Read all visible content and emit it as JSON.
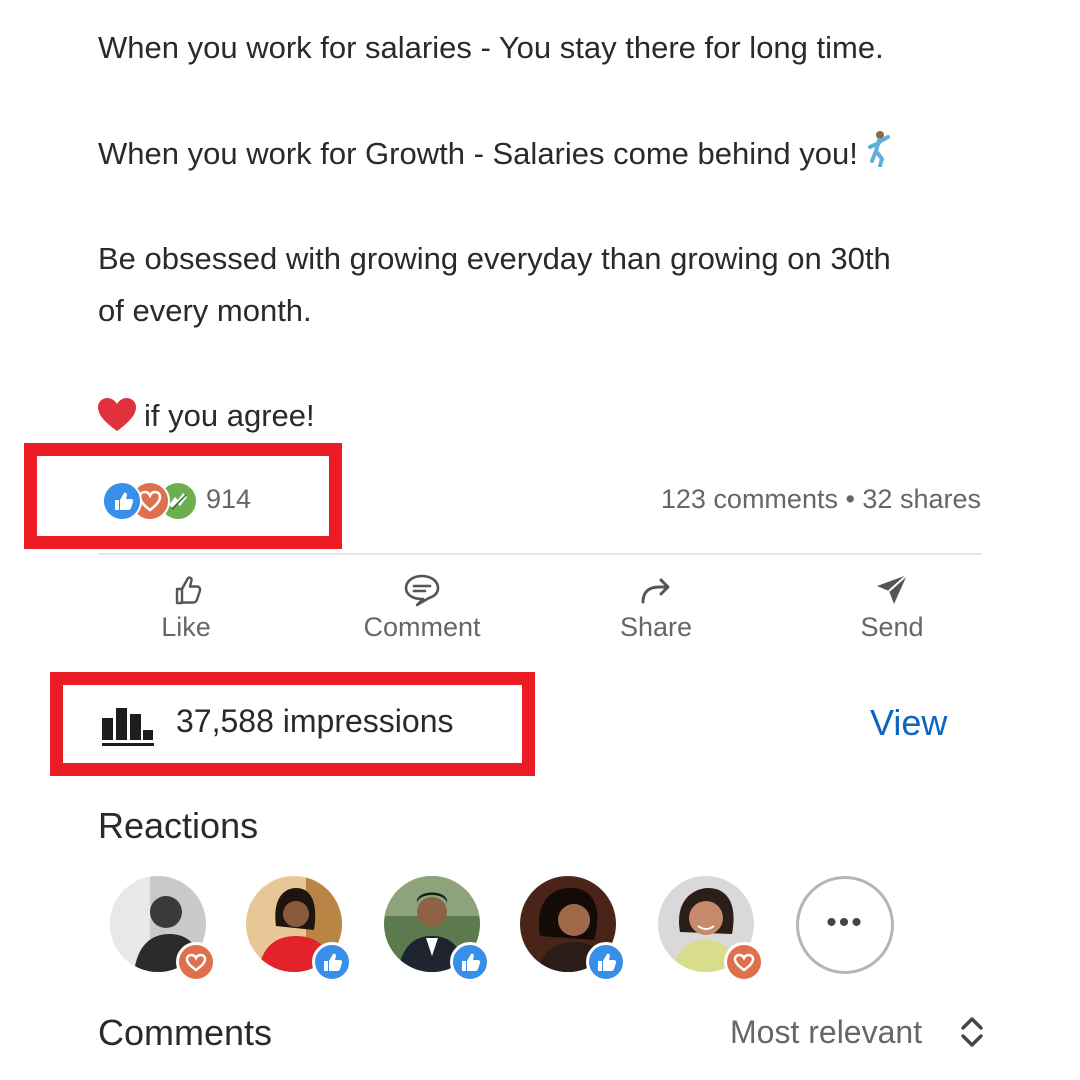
{
  "post": {
    "line1": "When you work for salaries - You stay there for long time.",
    "line2": "When you work for Growth - Salaries come behind you!",
    "line3a": "Be obsessed with growing everyday than growing on 30th",
    "line3b": "of every month.",
    "line4": "if you agree!"
  },
  "stats": {
    "reaction_count": "914",
    "comments_shares": "123 comments • 32 shares"
  },
  "actions": {
    "like": "Like",
    "comment": "Comment",
    "share": "Share",
    "send": "Send"
  },
  "analytics": {
    "impressions": "37,588 impressions",
    "view": "View"
  },
  "reactions": {
    "title": "Reactions",
    "more": "•••"
  },
  "comments": {
    "title": "Comments",
    "sort": "Most relevant"
  },
  "colors": {
    "accent_link": "#0a66c2",
    "highlight_box": "#ec1c24",
    "like_blue": "#378fe9",
    "love_orange": "#df704d",
    "support_green": "#6dae4f"
  }
}
